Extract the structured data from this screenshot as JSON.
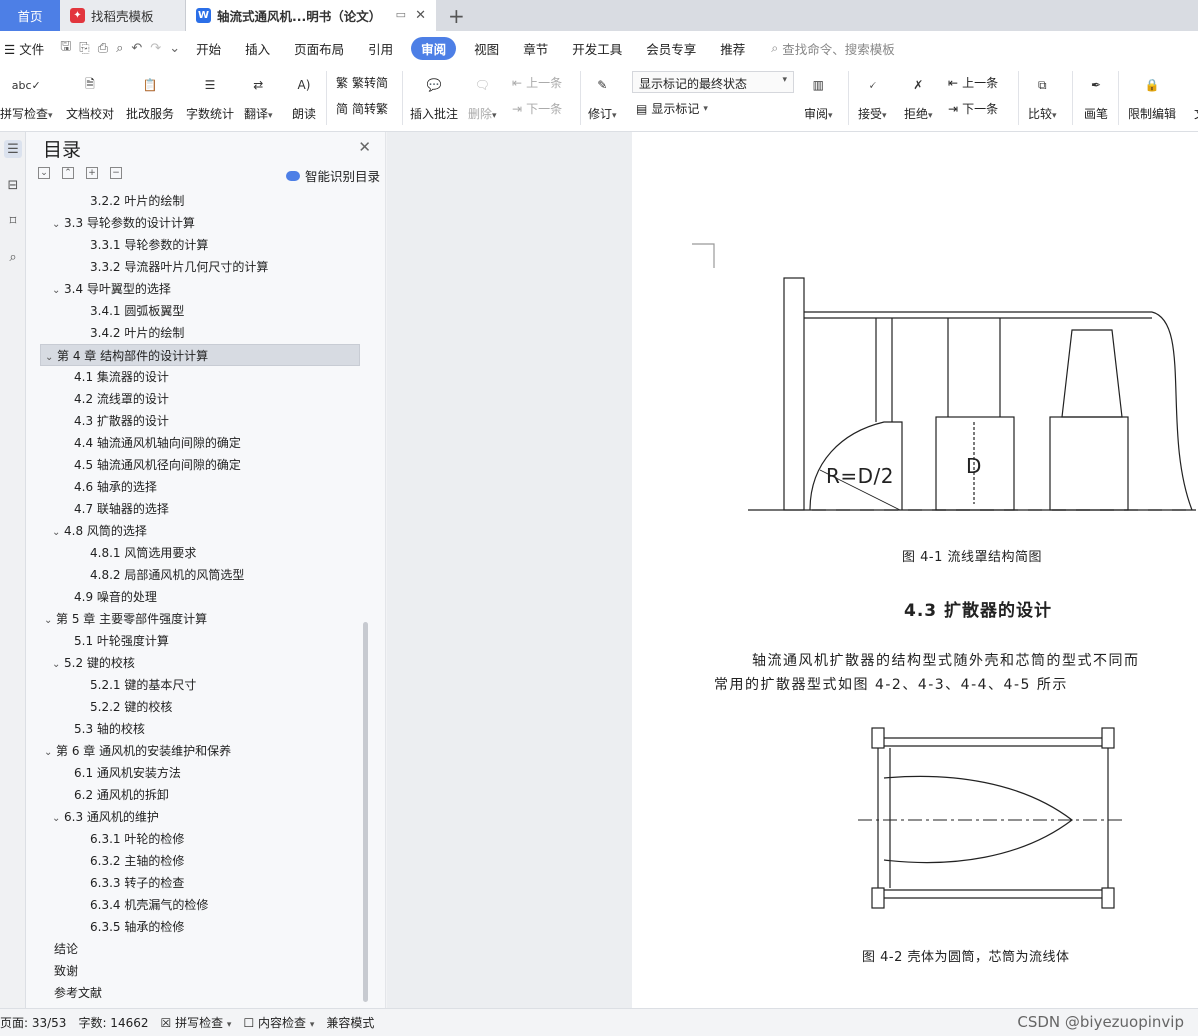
{
  "tabs": {
    "home": "首页",
    "template": "找稻壳模板",
    "doc": "轴流式通风机...明书（论文）",
    "new_tab": "+"
  },
  "menu": {
    "file": "文件",
    "items": [
      "开始",
      "插入",
      "页面布局",
      "引用",
      "审阅",
      "视图",
      "章节",
      "开发工具",
      "会员专享",
      "推荐"
    ],
    "active": "审阅",
    "search_placeholder": "查找命令、搜索模板"
  },
  "ribbon": {
    "spell_check": "拼写检查",
    "doc_proof": "文档校对",
    "review_service": "批改服务",
    "word_count": "字数统计",
    "translate": "翻译",
    "read_aloud": "朗读",
    "trad_to_simp": "繁转简",
    "simp_to_trad": "简转繁",
    "insert_comment": "插入批注",
    "delete": "删除",
    "prev_comment": "上一条",
    "next_comment": "下一条",
    "track_changes": "修订",
    "markup_state": "显示标记的最终状态",
    "show_markup": "显示标记",
    "review": "审阅",
    "accept": "接受",
    "reject": "拒绝",
    "prev_change": "上一条",
    "next_change": "下一条",
    "compare": "比较",
    "ink": "画笔",
    "restrict_edit": "限制编辑",
    "cut_text": "文"
  },
  "toc_panel": {
    "title": "目录",
    "smart_toc": "智能识别目录",
    "items": [
      {
        "level": 3,
        "text": "3.2.2 叶片的绘制",
        "caret": ""
      },
      {
        "level": 2,
        "text": "3.3 导轮参数的设计计算",
        "caret": "v"
      },
      {
        "level": 3,
        "text": "3.3.1 导轮参数的计算",
        "caret": ""
      },
      {
        "level": 3,
        "text": "3.3.2 导流器叶片几何尺寸的计算",
        "caret": ""
      },
      {
        "level": 2,
        "text": "3.4 导叶翼型的选择",
        "caret": "v"
      },
      {
        "level": 3,
        "text": "3.4.1  圆弧板翼型",
        "caret": ""
      },
      {
        "level": 3,
        "text": "3.4.2 叶片的绘制",
        "caret": ""
      },
      {
        "level": 1,
        "text": "第 4 章  结构部件的设计计算",
        "caret": "v",
        "selected": true
      },
      {
        "level": 2,
        "text": "4.1 集流器的设计",
        "caret": ""
      },
      {
        "level": 2,
        "text": "4.2 流线罩的设计",
        "caret": ""
      },
      {
        "level": 2,
        "text": "4.3 扩散器的设计",
        "caret": ""
      },
      {
        "level": 2,
        "text": "4.4 轴流通风机轴向间隙的确定",
        "caret": ""
      },
      {
        "level": 2,
        "text": "4.5 轴流通风机径向间隙的确定",
        "caret": ""
      },
      {
        "level": 2,
        "text": "4.6 轴承的选择",
        "caret": ""
      },
      {
        "level": 2,
        "text": "4.7 联轴器的选择",
        "caret": ""
      },
      {
        "level": 2,
        "text": "4.8 风筒的选择",
        "caret": "v"
      },
      {
        "level": 3,
        "text": "4.8.1 风筒选用要求",
        "caret": ""
      },
      {
        "level": 3,
        "text": "4.8.2 局部通风机的风筒选型",
        "caret": ""
      },
      {
        "level": 2,
        "text": "4.9 噪音的处理",
        "caret": ""
      },
      {
        "level": 1,
        "text": "第 5 章  主要零部件强度计算",
        "caret": "v"
      },
      {
        "level": 2,
        "text": "5.1 叶轮强度计算",
        "caret": ""
      },
      {
        "level": 2,
        "text": "5.2 键的校核",
        "caret": "v"
      },
      {
        "level": 3,
        "text": "5.2.1  键的基本尺寸",
        "caret": ""
      },
      {
        "level": 3,
        "text": "5.2.2  键的校核",
        "caret": ""
      },
      {
        "level": 2,
        "text": "5.3 轴的校核",
        "caret": ""
      },
      {
        "level": 1,
        "text": "第 6 章  通风机的安装维护和保养",
        "caret": "v"
      },
      {
        "level": 2,
        "text": "6.1 通风机安装方法",
        "caret": ""
      },
      {
        "level": 2,
        "text": "6.2 通风机的拆卸",
        "caret": ""
      },
      {
        "level": 2,
        "text": "6.3 通风机的维护",
        "caret": "v"
      },
      {
        "level": 3,
        "text": "6.3.1 叶轮的检修",
        "caret": ""
      },
      {
        "level": 3,
        "text": "6.3.2 主轴的检修",
        "caret": ""
      },
      {
        "level": 3,
        "text": "6.3.3 转子的检查",
        "caret": ""
      },
      {
        "level": 3,
        "text": "6.3.4 机壳漏气的检修",
        "caret": ""
      },
      {
        "level": 3,
        "text": "6.3.5 轴承的检修",
        "caret": ""
      },
      {
        "level": 1,
        "text": "结论",
        "caret": ""
      },
      {
        "level": 1,
        "text": "致谢",
        "caret": ""
      },
      {
        "level": 1,
        "text": "参考文献",
        "caret": ""
      }
    ]
  },
  "document": {
    "fig1_label_r": "R=D/2",
    "fig1_label_d": "D",
    "fig1_caption": "图 4-1  流线罩结构简图",
    "section_heading": "4.3 扩散器的设计",
    "para_line1": "轴流通风机扩散器的结构型式随外壳和芯筒的型式不同而",
    "para_line2": "常用的扩散器型式如图 4-2、4-3、4-4、4-5 所示",
    "fig2_caption": "图 4-2  壳体为圆筒，芯筒为流线体"
  },
  "status": {
    "page": "页面: 33/53",
    "words": "字数: 14662",
    "spell": "拼写检查",
    "content_check": "内容检查",
    "compat": "兼容模式",
    "watermark": "CSDN @biyezuopinvip"
  },
  "colors": {
    "accent": "#4d7fe6",
    "tab_bar": "#d9dce2",
    "toc_selected": "#d7dbe2"
  }
}
